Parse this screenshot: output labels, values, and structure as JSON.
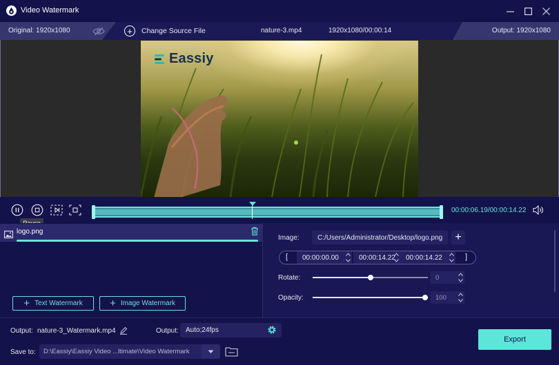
{
  "window": {
    "title": "Video Watermark",
    "minimize_icon": "minimize-icon",
    "maximize_icon": "maximize-icon",
    "close_icon": "close-icon"
  },
  "infobar": {
    "original_label": "Original: 1920x1080",
    "change_source_label": "Change Source File",
    "file_name": "nature-3.mp4",
    "file_info": "1920x1080/00:00:14",
    "output_label": "Output: 1920x1080"
  },
  "preview": {
    "watermark_text": "Eassiy",
    "watermark_color": "#16314d"
  },
  "playback": {
    "pause_tooltip": "Pause",
    "time": "00:00:06.19/00:00:14.22",
    "progress": 0.4535
  },
  "watermark_list": {
    "items": [
      {
        "name": "logo.png",
        "icon": "image-icon"
      }
    ],
    "add_text_label": "Text Watermark",
    "add_image_label": "Image Watermark"
  },
  "settings": {
    "image_label": "Image:",
    "image_path": "C:/Users/Administrator/Desktop/logo.png",
    "start_time": "00:00:00.00",
    "end_time": "00:00:14.22",
    "duration": "00:00:14.22",
    "open_bracket": "[",
    "close_bracket": "]",
    "rotate_label": "Rotate:",
    "rotate_value": "0",
    "opacity_label": "Opacity:",
    "opacity_value": "100"
  },
  "bottom": {
    "output_name_label": "Output:",
    "output_name": "nature-3_Watermark.mp4",
    "output_format_label": "Output:",
    "output_format": "Auto;24fps",
    "save_label": "Save to:",
    "save_path": "D:\\Eassiy\\Eassiy Video ...ltimate\\Video Watermark",
    "export_label": "Export"
  },
  "colors": {
    "accent": "#5be6d9",
    "background": "#14124a",
    "panel": "#1a1854"
  }
}
